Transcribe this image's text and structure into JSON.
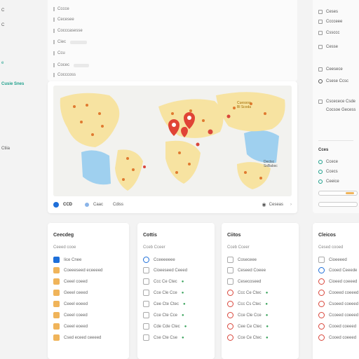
{
  "left_fragments": [
    "C",
    "C",
    "e",
    "Cusie Snes",
    "Ctiia"
  ],
  "top_list": [
    "Cccce",
    "Cecesee",
    "Cocccasesse",
    "Ciec",
    "Ccu",
    "Cocec",
    "Cocccoss"
  ],
  "map": {
    "label_region": "Cuessoo\nBl Scoda",
    "label_right": "Dectsc\nSsBabsc",
    "footer": {
      "code": "CCD",
      "b": "Caac",
      "c": "Cdiss",
      "d": "Ceseas"
    }
  },
  "right_panel": {
    "items": [
      "Ceses",
      "Cccceee",
      "Cssccc",
      "Cesse",
      "Ceesece"
    ],
    "g1": "Csese Ccsc",
    "g2a": "Cscecece Csde",
    "g2b": "Cocsoe Gecess",
    "section": "Cces",
    "radios": [
      "Ccece",
      "Ccecs",
      "Ceeice"
    ]
  },
  "columns": [
    {
      "title": "Ceecdeg",
      "sub": "Ceeed cooe",
      "items": [
        "Iice Cnee",
        "Coeeeseed eceeeed",
        "Ceeel coeed",
        "Geeel ceeed",
        "Ceeel eoeed",
        "Ceeel coeed",
        "Ceeel eoeed",
        "Csed eceed ceeeed"
      ]
    },
    {
      "title": "Cottis",
      "sub": "Cceb Cceer",
      "items": [
        "Cceeeeeee",
        "Cioeeseed Ceeed",
        "Ccc Ce Ctec",
        "Cce Cle Cce",
        "Cee Cte Ctec",
        "Cce Cte Cce",
        "Cde Cde Ctec",
        "Cse Cte Cse"
      ]
    },
    {
      "title": "Ciitos",
      "sub": "Cceb Cceer",
      "items": [
        "Coseceee",
        "Ceseed Coeee",
        "Cesecoseed",
        "Ccc Ce Ctec",
        "Ccc Cs Ctec",
        "Cce Cle Cce",
        "Cee Ce Ctec",
        "Cce Ce Ctec"
      ]
    },
    {
      "title": "Cleicos",
      "sub": "Cesed cooed",
      "items": [
        "Cioeeeed",
        "Cooed Ceeede",
        "Cioeed coeeed",
        "Cooeed coeeed",
        "Csoeed coeeed",
        "Ccoeed coeeed",
        "Cooed coeeed",
        "Cooed coeeed"
      ]
    }
  ]
}
